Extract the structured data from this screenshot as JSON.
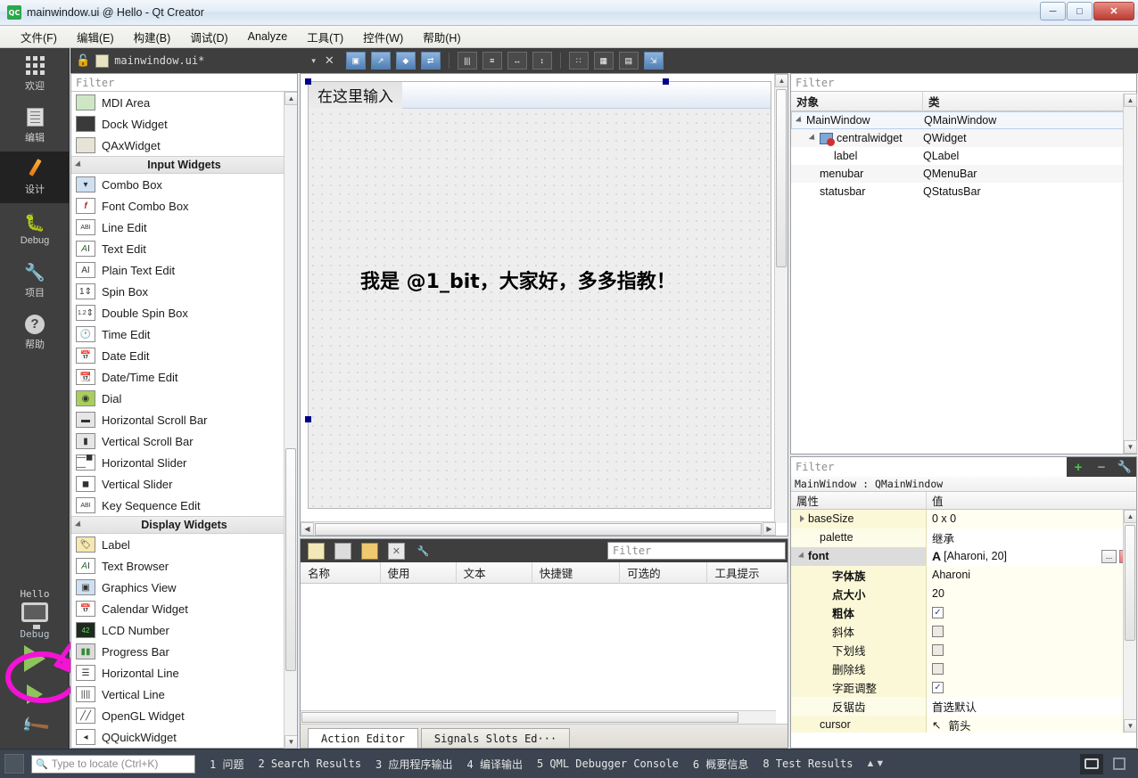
{
  "window": {
    "title": "mainwindow.ui @ Hello - Qt Creator",
    "app_icon": "QC",
    "minimize": "─",
    "maximize": "□",
    "close": "✕"
  },
  "menubar": {
    "items": [
      "文件(F)",
      "编辑(E)",
      "构建(B)",
      "调试(D)",
      "Analyze",
      "工具(T)",
      "控件(W)",
      "帮助(H)"
    ]
  },
  "modebar": {
    "modes": [
      {
        "label": "欢迎",
        "icon": "grid-icon"
      },
      {
        "label": "编辑",
        "icon": "document-icon"
      },
      {
        "label": "设计",
        "icon": "pencil-icon"
      },
      {
        "label": "Debug",
        "icon": "bug-icon"
      },
      {
        "label": "项目",
        "icon": "wrench-icon"
      },
      {
        "label": "帮助",
        "icon": "question-icon"
      }
    ],
    "active_index": 2,
    "run_area": {
      "kit_name": "Hello",
      "kit_label": "Debug",
      "run_tooltip": "运行",
      "debug_tooltip": "开始调试",
      "build_tooltip": "构建"
    }
  },
  "editor_toolbar": {
    "lock_icon": "unlock-icon",
    "filename": "mainwindow.ui*",
    "dropdown_arrow": "▾",
    "close_icon": "✕",
    "buttons": [
      "edit-widgets-icon",
      "edit-signals-icon",
      "edit-buddies-icon",
      "edit-tab-order-icon",
      "layout-horizontally-icon",
      "layout-vertically-icon",
      "layout-splitter-h-icon",
      "layout-splitter-v-icon",
      "layout-form-icon",
      "layout-grid-icon",
      "break-layout-icon",
      "adjust-size-icon"
    ]
  },
  "widget_box": {
    "filter_placeholder": "Filter",
    "items": [
      {
        "type": "item",
        "label": "MDI Area",
        "icon": "mdi-area-icon"
      },
      {
        "type": "item",
        "label": "Dock Widget",
        "icon": "dock-widget-icon"
      },
      {
        "type": "item",
        "label": "QAxWidget",
        "icon": "qax-widget-icon"
      },
      {
        "type": "section",
        "label": "Input Widgets"
      },
      {
        "type": "item",
        "label": "Combo Box",
        "icon": "combo-box-icon"
      },
      {
        "type": "item",
        "label": "Font Combo Box",
        "icon": "font-combo-box-icon"
      },
      {
        "type": "item",
        "label": "Line Edit",
        "icon": "line-edit-icon"
      },
      {
        "type": "item",
        "label": "Text Edit",
        "icon": "text-edit-icon"
      },
      {
        "type": "item",
        "label": "Plain Text Edit",
        "icon": "plain-text-edit-icon"
      },
      {
        "type": "item",
        "label": "Spin Box",
        "icon": "spin-box-icon"
      },
      {
        "type": "item",
        "label": "Double Spin Box",
        "icon": "double-spin-box-icon"
      },
      {
        "type": "item",
        "label": "Time Edit",
        "icon": "time-edit-icon"
      },
      {
        "type": "item",
        "label": "Date Edit",
        "icon": "date-edit-icon"
      },
      {
        "type": "item",
        "label": "Date/Time Edit",
        "icon": "date-time-edit-icon"
      },
      {
        "type": "item",
        "label": "Dial",
        "icon": "dial-icon"
      },
      {
        "type": "item",
        "label": "Horizontal Scroll Bar",
        "icon": "h-scrollbar-icon"
      },
      {
        "type": "item",
        "label": "Vertical Scroll Bar",
        "icon": "v-scrollbar-icon"
      },
      {
        "type": "item",
        "label": "Horizontal Slider",
        "icon": "h-slider-icon"
      },
      {
        "type": "item",
        "label": "Vertical Slider",
        "icon": "v-slider-icon"
      },
      {
        "type": "item",
        "label": "Key Sequence Edit",
        "icon": "key-sequence-edit-icon"
      },
      {
        "type": "section",
        "label": "Display Widgets"
      },
      {
        "type": "item",
        "label": "Label",
        "icon": "label-icon"
      },
      {
        "type": "item",
        "label": "Text Browser",
        "icon": "text-browser-icon"
      },
      {
        "type": "item",
        "label": "Graphics View",
        "icon": "graphics-view-icon"
      },
      {
        "type": "item",
        "label": "Calendar Widget",
        "icon": "calendar-widget-icon"
      },
      {
        "type": "item",
        "label": "LCD Number",
        "icon": "lcd-number-icon"
      },
      {
        "type": "item",
        "label": "Progress Bar",
        "icon": "progress-bar-icon"
      },
      {
        "type": "item",
        "label": "Horizontal Line",
        "icon": "h-line-icon"
      },
      {
        "type": "item",
        "label": "Vertical Line",
        "icon": "v-line-icon"
      },
      {
        "type": "item",
        "label": "OpenGL Widget",
        "icon": "opengl-widget-icon"
      },
      {
        "type": "item",
        "label": "QQuickWidget",
        "icon": "qquick-widget-icon"
      }
    ]
  },
  "canvas": {
    "menubar_placeholder": "在这里输入",
    "label_text": "我是 @1_bit，大家好，多多指教！"
  },
  "action_editor": {
    "toolbar_icons": [
      "new-action-icon",
      "copy-icon",
      "paste-icon",
      "delete-icon",
      "configure-icon"
    ],
    "filter_placeholder": "Filter",
    "columns": [
      "名称",
      "使用",
      "文本",
      "快捷键",
      "可选的",
      "工具提示"
    ],
    "rows": [],
    "tabs": [
      {
        "label": "Action Editor",
        "active": true
      },
      {
        "label": "Signals  Slots Ed···",
        "active": false
      }
    ]
  },
  "object_inspector": {
    "filter_placeholder": "Filter",
    "columns": [
      "对象",
      "类"
    ],
    "rows": [
      {
        "indent": 0,
        "expander": true,
        "name": "MainWindow",
        "class": "QMainWindow",
        "selected": true,
        "icon": ""
      },
      {
        "indent": 1,
        "expander": true,
        "name": "centralwidget",
        "class": "QWidget",
        "selected": false,
        "icon": "no-layout-icon"
      },
      {
        "indent": 2,
        "expander": false,
        "name": "label",
        "class": "QLabel",
        "selected": false,
        "icon": ""
      },
      {
        "indent": 1,
        "expander": false,
        "name": "menubar",
        "class": "QMenuBar",
        "selected": false,
        "icon": ""
      },
      {
        "indent": 1,
        "expander": false,
        "name": "statusbar",
        "class": "QStatusBar",
        "selected": false,
        "icon": ""
      }
    ]
  },
  "property_editor": {
    "filter_placeholder": "Filter",
    "add_label": "+",
    "remove_label": "−",
    "configure_label": "🔧",
    "object_line": "MainWindow : QMainWindow",
    "columns": [
      "属性",
      "值"
    ],
    "rows": [
      {
        "name": "baseSize",
        "value": "0 x 0",
        "indent": 0,
        "expander": "closed",
        "bold": false,
        "kind": "text"
      },
      {
        "name": "palette",
        "value": "继承",
        "indent": 1,
        "expander": "none",
        "bold": false,
        "kind": "text"
      },
      {
        "name": "font",
        "value": "[Aharoni, 20]",
        "indent": 0,
        "expander": "open",
        "bold": true,
        "kind": "font"
      },
      {
        "name": "字体族",
        "value": "Aharoni",
        "indent": 2,
        "expander": "none",
        "bold": true,
        "kind": "text"
      },
      {
        "name": "点大小",
        "value": "20",
        "indent": 2,
        "expander": "none",
        "bold": true,
        "kind": "text"
      },
      {
        "name": "粗体",
        "value": "",
        "indent": 2,
        "expander": "none",
        "bold": true,
        "kind": "checkbox-checked"
      },
      {
        "name": "斜体",
        "value": "",
        "indent": 2,
        "expander": "none",
        "bold": false,
        "kind": "checkbox"
      },
      {
        "name": "下划线",
        "value": "",
        "indent": 2,
        "expander": "none",
        "bold": false,
        "kind": "checkbox"
      },
      {
        "name": "删除线",
        "value": "",
        "indent": 2,
        "expander": "none",
        "bold": false,
        "kind": "checkbox"
      },
      {
        "name": "字距调整",
        "value": "",
        "indent": 2,
        "expander": "none",
        "bold": false,
        "kind": "checkbox-checked"
      },
      {
        "name": "反锯齿",
        "value": "首选默认",
        "indent": 2,
        "expander": "none",
        "bold": false,
        "kind": "text"
      },
      {
        "name": "cursor",
        "value": "箭头",
        "indent": 1,
        "expander": "none",
        "bold": false,
        "kind": "cursor"
      }
    ],
    "font_ellipsis_button": "...",
    "font_reset_button": "↩"
  },
  "statusbar": {
    "locate_placeholder": "Type to locate (Ctrl+K)",
    "panels": [
      "1 问题",
      "2 Search Results",
      "3 应用程序输出",
      "4 编译输出",
      "5 QML Debugger Console",
      "6 概要信息",
      "8 Test Results"
    ]
  },
  "colors": {
    "highlight_pink": "#f312d6",
    "mode_active_bg": "#222222",
    "property_yellow": "#fbf8d8",
    "run_green": "#8dc45d"
  }
}
